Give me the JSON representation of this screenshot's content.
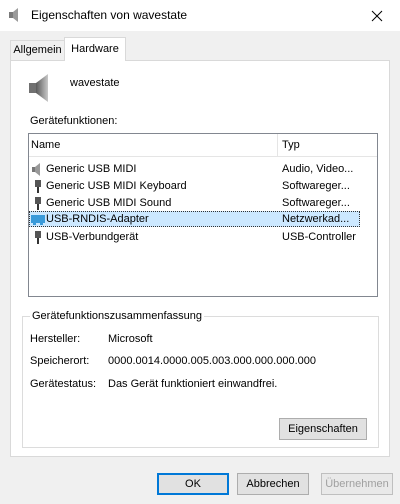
{
  "window": {
    "title": "Eigenschaften von wavestate"
  },
  "tabs": [
    {
      "label": "Allgemein"
    },
    {
      "label": "Hardware"
    }
  ],
  "device": {
    "name": "wavestate",
    "icon": "speaker-icon"
  },
  "functions": {
    "label": "Gerätefunktionen:",
    "columns": [
      "Name",
      "Typ"
    ],
    "rows": [
      {
        "name": "Generic USB MIDI",
        "type": "Audio, Video...",
        "icon": "speaker-small-icon"
      },
      {
        "name": "Generic USB MIDI Keyboard",
        "type": "Softwareger...",
        "icon": "usb-plug-icon"
      },
      {
        "name": "Generic USB MIDI Sound",
        "type": "Softwareger...",
        "icon": "usb-plug-icon"
      },
      {
        "name": "USB-RNDIS-Adapter",
        "type": "Netzwerkad...",
        "icon": "network-adapter-icon",
        "selected": true
      },
      {
        "name": "USB-Verbundgerät",
        "type": "USB-Controller",
        "icon": "usb-plug-icon"
      }
    ]
  },
  "summary": {
    "legend": "Gerätefunktionszusammenfassung",
    "manufacturer_label": "Hersteller:",
    "manufacturer_value": "Microsoft",
    "location_label": "Speicherort:",
    "location_value": "0000.0014.0000.005.003.000.000.000.000",
    "status_label": "Gerätestatus:",
    "status_value": "Das Gerät funktioniert einwandfrei.",
    "properties_button": "Eigenschaften"
  },
  "footer": {
    "ok": "OK",
    "cancel": "Abbrechen",
    "apply": "Übernehmen"
  },
  "colors": {
    "selection": "#cce8ff",
    "accent": "#0078d7"
  }
}
